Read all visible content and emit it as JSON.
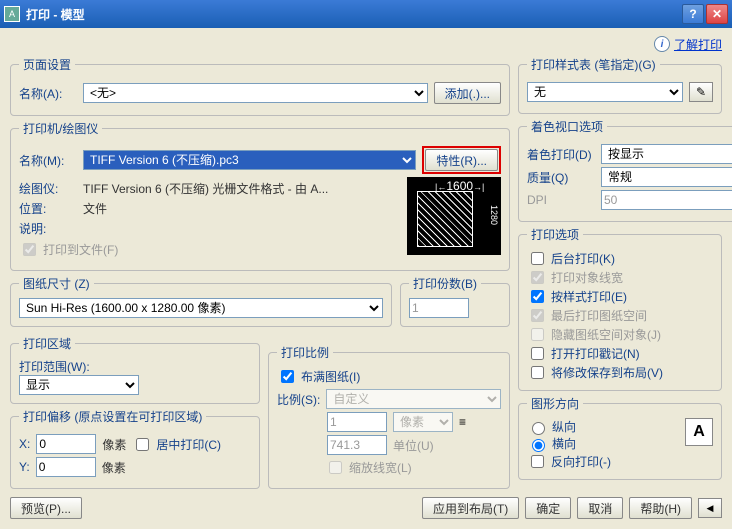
{
  "window": {
    "title": "打印 - 模型"
  },
  "learn_link": "了解打印",
  "page_setup": {
    "legend": "页面设置",
    "name_label": "名称(A):",
    "name_value": "<无>",
    "add_btn": "添加(.)..."
  },
  "printer": {
    "legend": "打印机/绘图仪",
    "name_label": "名称(M):",
    "name_value": "TIFF Version 6 (不压缩).pc3",
    "props_btn": "特性(R)...",
    "plotter_label": "绘图仪:",
    "plotter_value": "TIFF Version 6 (不压缩) 光栅文件格式 - 由 A...",
    "location_label": "位置:",
    "location_value": "文件",
    "desc_label": "说明:",
    "desc_value": "",
    "to_file": "打印到文件(F)",
    "preview_w": "1600",
    "preview_h": "1280"
  },
  "paper": {
    "legend": "图纸尺寸 (Z)",
    "value": "Sun Hi-Res (1600.00 x 1280.00 像素)"
  },
  "copies": {
    "legend": "打印份数(B)",
    "value": "1"
  },
  "area": {
    "legend": "打印区域",
    "range_label": "打印范围(W):",
    "range_value": "显示"
  },
  "scale": {
    "legend": "打印比例",
    "fit": "布满图纸(I)",
    "ratio_label": "比例(S):",
    "ratio_value": "自定义",
    "num": "1",
    "unit": "像素",
    "denom": "741.3",
    "denom_unit": "单位(U)",
    "scale_lw": "缩放线宽(L)"
  },
  "offset": {
    "legend": "打印偏移 (原点设置在可打印区域)",
    "x_label": "X:",
    "x_value": "0",
    "x_unit": "像素",
    "y_label": "Y:",
    "y_value": "0",
    "y_unit": "像素",
    "center": "居中打印(C)"
  },
  "style": {
    "legend": "打印样式表 (笔指定)(G)",
    "value": "无"
  },
  "viewport": {
    "legend": "着色视口选项",
    "shade_label": "着色打印(D)",
    "shade_value": "按显示",
    "quality_label": "质量(Q)",
    "quality_value": "常规",
    "dpi_label": "DPI",
    "dpi_value": "50"
  },
  "options": {
    "legend": "打印选项",
    "bg": "后台打印(K)",
    "lw": "打印对象线宽",
    "style": "按样式打印(E)",
    "last": "最后打印图纸空间",
    "hide": "隐藏图纸空间对象(J)",
    "stamp": "打开打印戳记(N)",
    "save": "将修改保存到布局(V)"
  },
  "orient": {
    "legend": "图形方向",
    "portrait": "纵向",
    "landscape": "横向",
    "reverse": "反向打印(-)"
  },
  "footer": {
    "preview": "预览(P)...",
    "apply": "应用到布局(T)",
    "ok": "确定",
    "cancel": "取消",
    "help": "帮助(H)"
  }
}
